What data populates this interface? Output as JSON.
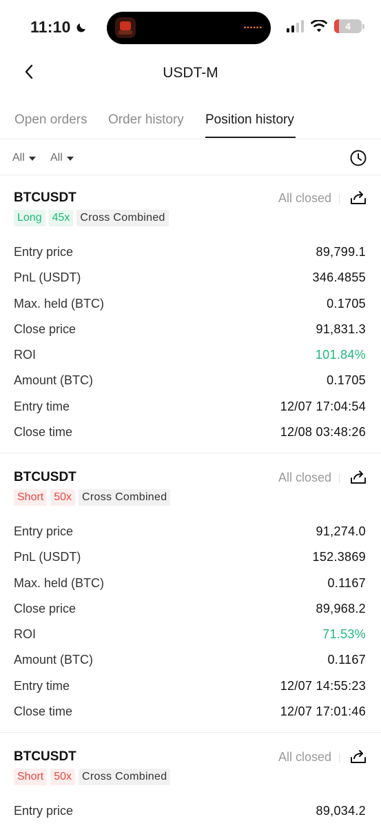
{
  "status_bar": {
    "time": "11:10",
    "battery": "4"
  },
  "header": {
    "title": "USDT-M"
  },
  "tabs": [
    {
      "label": "Open orders",
      "active": false
    },
    {
      "label": "Order history",
      "active": false
    },
    {
      "label": "Position history",
      "active": true
    }
  ],
  "filters": {
    "first": "All",
    "second": "All"
  },
  "colors": {
    "profit_green": "#20b87a",
    "loss_red": "#e5483f",
    "text": "#1a1a1a",
    "muted": "#9a9a9a"
  },
  "positions": [
    {
      "symbol": "BTCUSDT",
      "status": "All closed",
      "side": "Long",
      "leverage": "45x",
      "margin": "Cross Combined",
      "rows": [
        {
          "label": "Entry price",
          "value": "89,799.1"
        },
        {
          "label": "PnL (USDT)",
          "value": "346.4855"
        },
        {
          "label": "Max. held (BTC)",
          "value": "0.1705"
        },
        {
          "label": "Close price",
          "value": "91,831.3"
        },
        {
          "label": "ROI",
          "value": "101.84%"
        },
        {
          "label": "Amount (BTC)",
          "value": "0.1705"
        },
        {
          "label": "Entry time",
          "value": "12/07 17:04:54"
        },
        {
          "label": "Close time",
          "value": "12/08 03:48:26"
        }
      ]
    },
    {
      "symbol": "BTCUSDT",
      "status": "All closed",
      "side": "Short",
      "leverage": "50x",
      "margin": "Cross Combined",
      "rows": [
        {
          "label": "Entry price",
          "value": "91,274.0"
        },
        {
          "label": "PnL (USDT)",
          "value": "152.3869"
        },
        {
          "label": "Max. held (BTC)",
          "value": "0.1167"
        },
        {
          "label": "Close price",
          "value": "89,968.2"
        },
        {
          "label": "ROI",
          "value": "71.53%"
        },
        {
          "label": "Amount (BTC)",
          "value": "0.1167"
        },
        {
          "label": "Entry time",
          "value": "12/07 14:55:23"
        },
        {
          "label": "Close time",
          "value": "12/07 17:01:46"
        }
      ]
    },
    {
      "symbol": "BTCUSDT",
      "status": "All closed",
      "side": "Short",
      "leverage": "50x",
      "margin": "Cross Combined",
      "rows": [
        {
          "label": "Entry price",
          "value": "89,034.2"
        }
      ]
    }
  ]
}
